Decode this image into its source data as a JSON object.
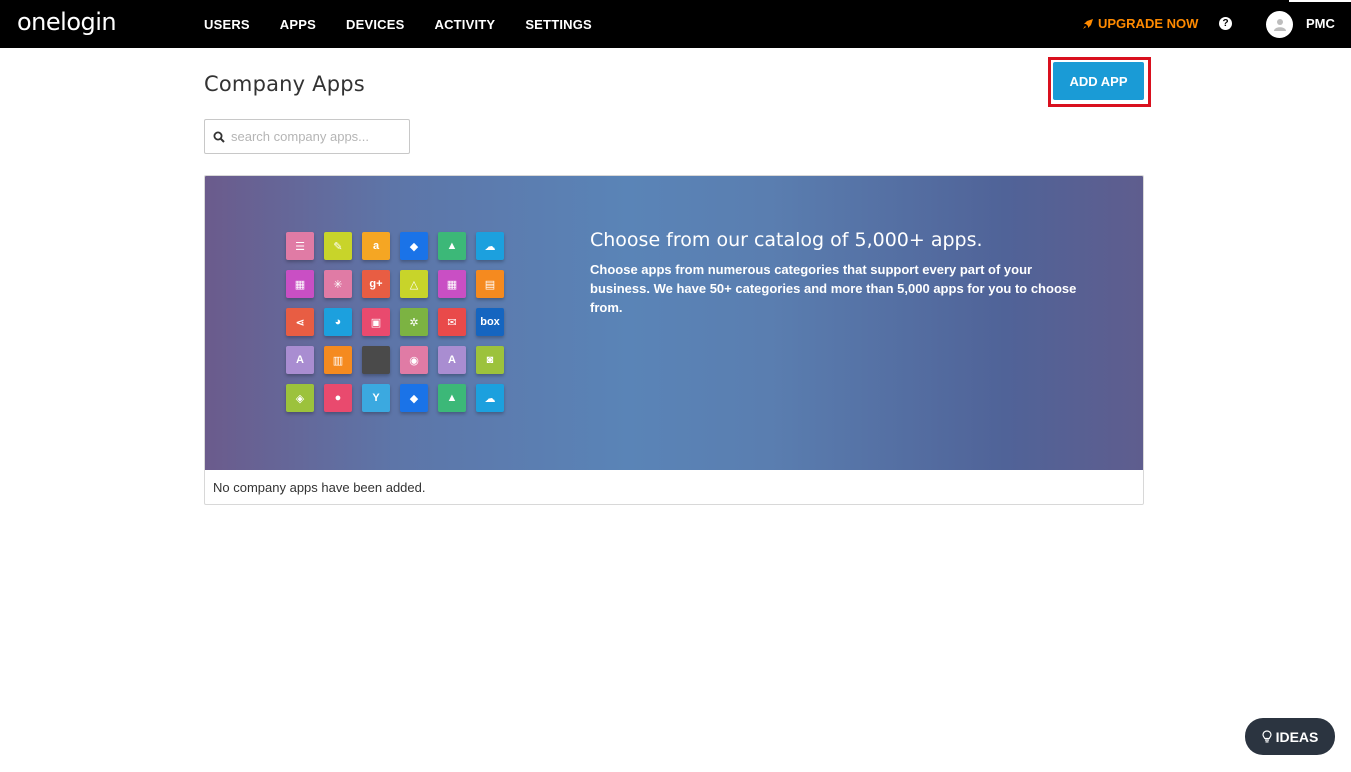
{
  "brand": {
    "logo": "onelogin"
  },
  "nav": {
    "items": [
      "USERS",
      "APPS",
      "DEVICES",
      "ACTIVITY",
      "SETTINGS"
    ],
    "upgrade": "UPGRADE NOW",
    "help": "?",
    "user": "PMC"
  },
  "page": {
    "title": "Company Apps",
    "add_button": "ADD APP",
    "search_placeholder": "search company apps..."
  },
  "banner": {
    "title": "Choose from our catalog of 5,000+ apps.",
    "description": "Choose apps from numerous categories that support every part of your business. We have 50+ categories and more than 5,000 apps for you to choose from.",
    "tiles": [
      {
        "icon": "list-icon",
        "color": "#e07ba5",
        "glyph": "☰"
      },
      {
        "icon": "pencil-icon",
        "color": "#c8d42a",
        "glyph": "✎"
      },
      {
        "icon": "amazon-icon",
        "color": "#f5a623",
        "glyph": "a"
      },
      {
        "icon": "dropbox-icon",
        "color": "#1a73e8",
        "glyph": "◆"
      },
      {
        "icon": "chart-icon",
        "color": "#3cb878",
        "glyph": "▲"
      },
      {
        "icon": "salesforce-icon",
        "color": "#1ca0de",
        "glyph": "☁"
      },
      {
        "icon": "calendar-icon",
        "color": "#c94fc4",
        "glyph": "▦"
      },
      {
        "icon": "network-icon",
        "color": "#e07ba5",
        "glyph": "✳"
      },
      {
        "icon": "google-plus-icon",
        "color": "#e85d43",
        "glyph": "g+"
      },
      {
        "icon": "google-drive-icon",
        "color": "#c8d42a",
        "glyph": "△"
      },
      {
        "icon": "calendar-icon",
        "color": "#c94fc4",
        "glyph": "▦"
      },
      {
        "icon": "layout-icon",
        "color": "#f58a1f",
        "glyph": "▤"
      },
      {
        "icon": "share-icon",
        "color": "#e85d43",
        "glyph": "⋖"
      },
      {
        "icon": "pie-chart-icon",
        "color": "#1ca0de",
        "glyph": "◕"
      },
      {
        "icon": "office-icon",
        "color": "#e94a6e",
        "glyph": "▣"
      },
      {
        "icon": "gear-icon",
        "color": "#7cb342",
        "glyph": "✲"
      },
      {
        "icon": "mail-icon",
        "color": "#e94a4a",
        "glyph": "✉"
      },
      {
        "icon": "box-icon",
        "color": "#1565c0",
        "glyph": "box"
      },
      {
        "icon": "app-store-icon",
        "color": "#a98dd1",
        "glyph": "A"
      },
      {
        "icon": "save-icon",
        "color": "#f58a1f",
        "glyph": "▥"
      },
      {
        "icon": "apple-icon",
        "color": "#4a4a4a",
        "glyph": ""
      },
      {
        "icon": "rss-icon",
        "color": "#e07ba5",
        "glyph": "◉"
      },
      {
        "icon": "app-store-icon",
        "color": "#a98dd1",
        "glyph": "A"
      },
      {
        "icon": "android-icon",
        "color": "#9cc23c",
        "glyph": "◙"
      },
      {
        "icon": "tag-icon",
        "color": "#9cc23c",
        "glyph": "◈"
      },
      {
        "icon": "chat-icon",
        "color": "#e94a6e",
        "glyph": "●"
      },
      {
        "icon": "filter-icon",
        "color": "#3ba9e0",
        "glyph": "Y"
      },
      {
        "icon": "dropbox-icon",
        "color": "#1a73e8",
        "glyph": "◆"
      },
      {
        "icon": "chart-icon",
        "color": "#3cb878",
        "glyph": "▲"
      },
      {
        "icon": "salesforce-icon",
        "color": "#1ca0de",
        "glyph": "☁"
      }
    ]
  },
  "empty_message": "No company apps have been added.",
  "ideas_button": "IDEAS",
  "colors": {
    "accent": "#1a9bd6",
    "upgrade": "#ff8a00",
    "highlight": "#d9101e",
    "topbar": "#000000"
  }
}
